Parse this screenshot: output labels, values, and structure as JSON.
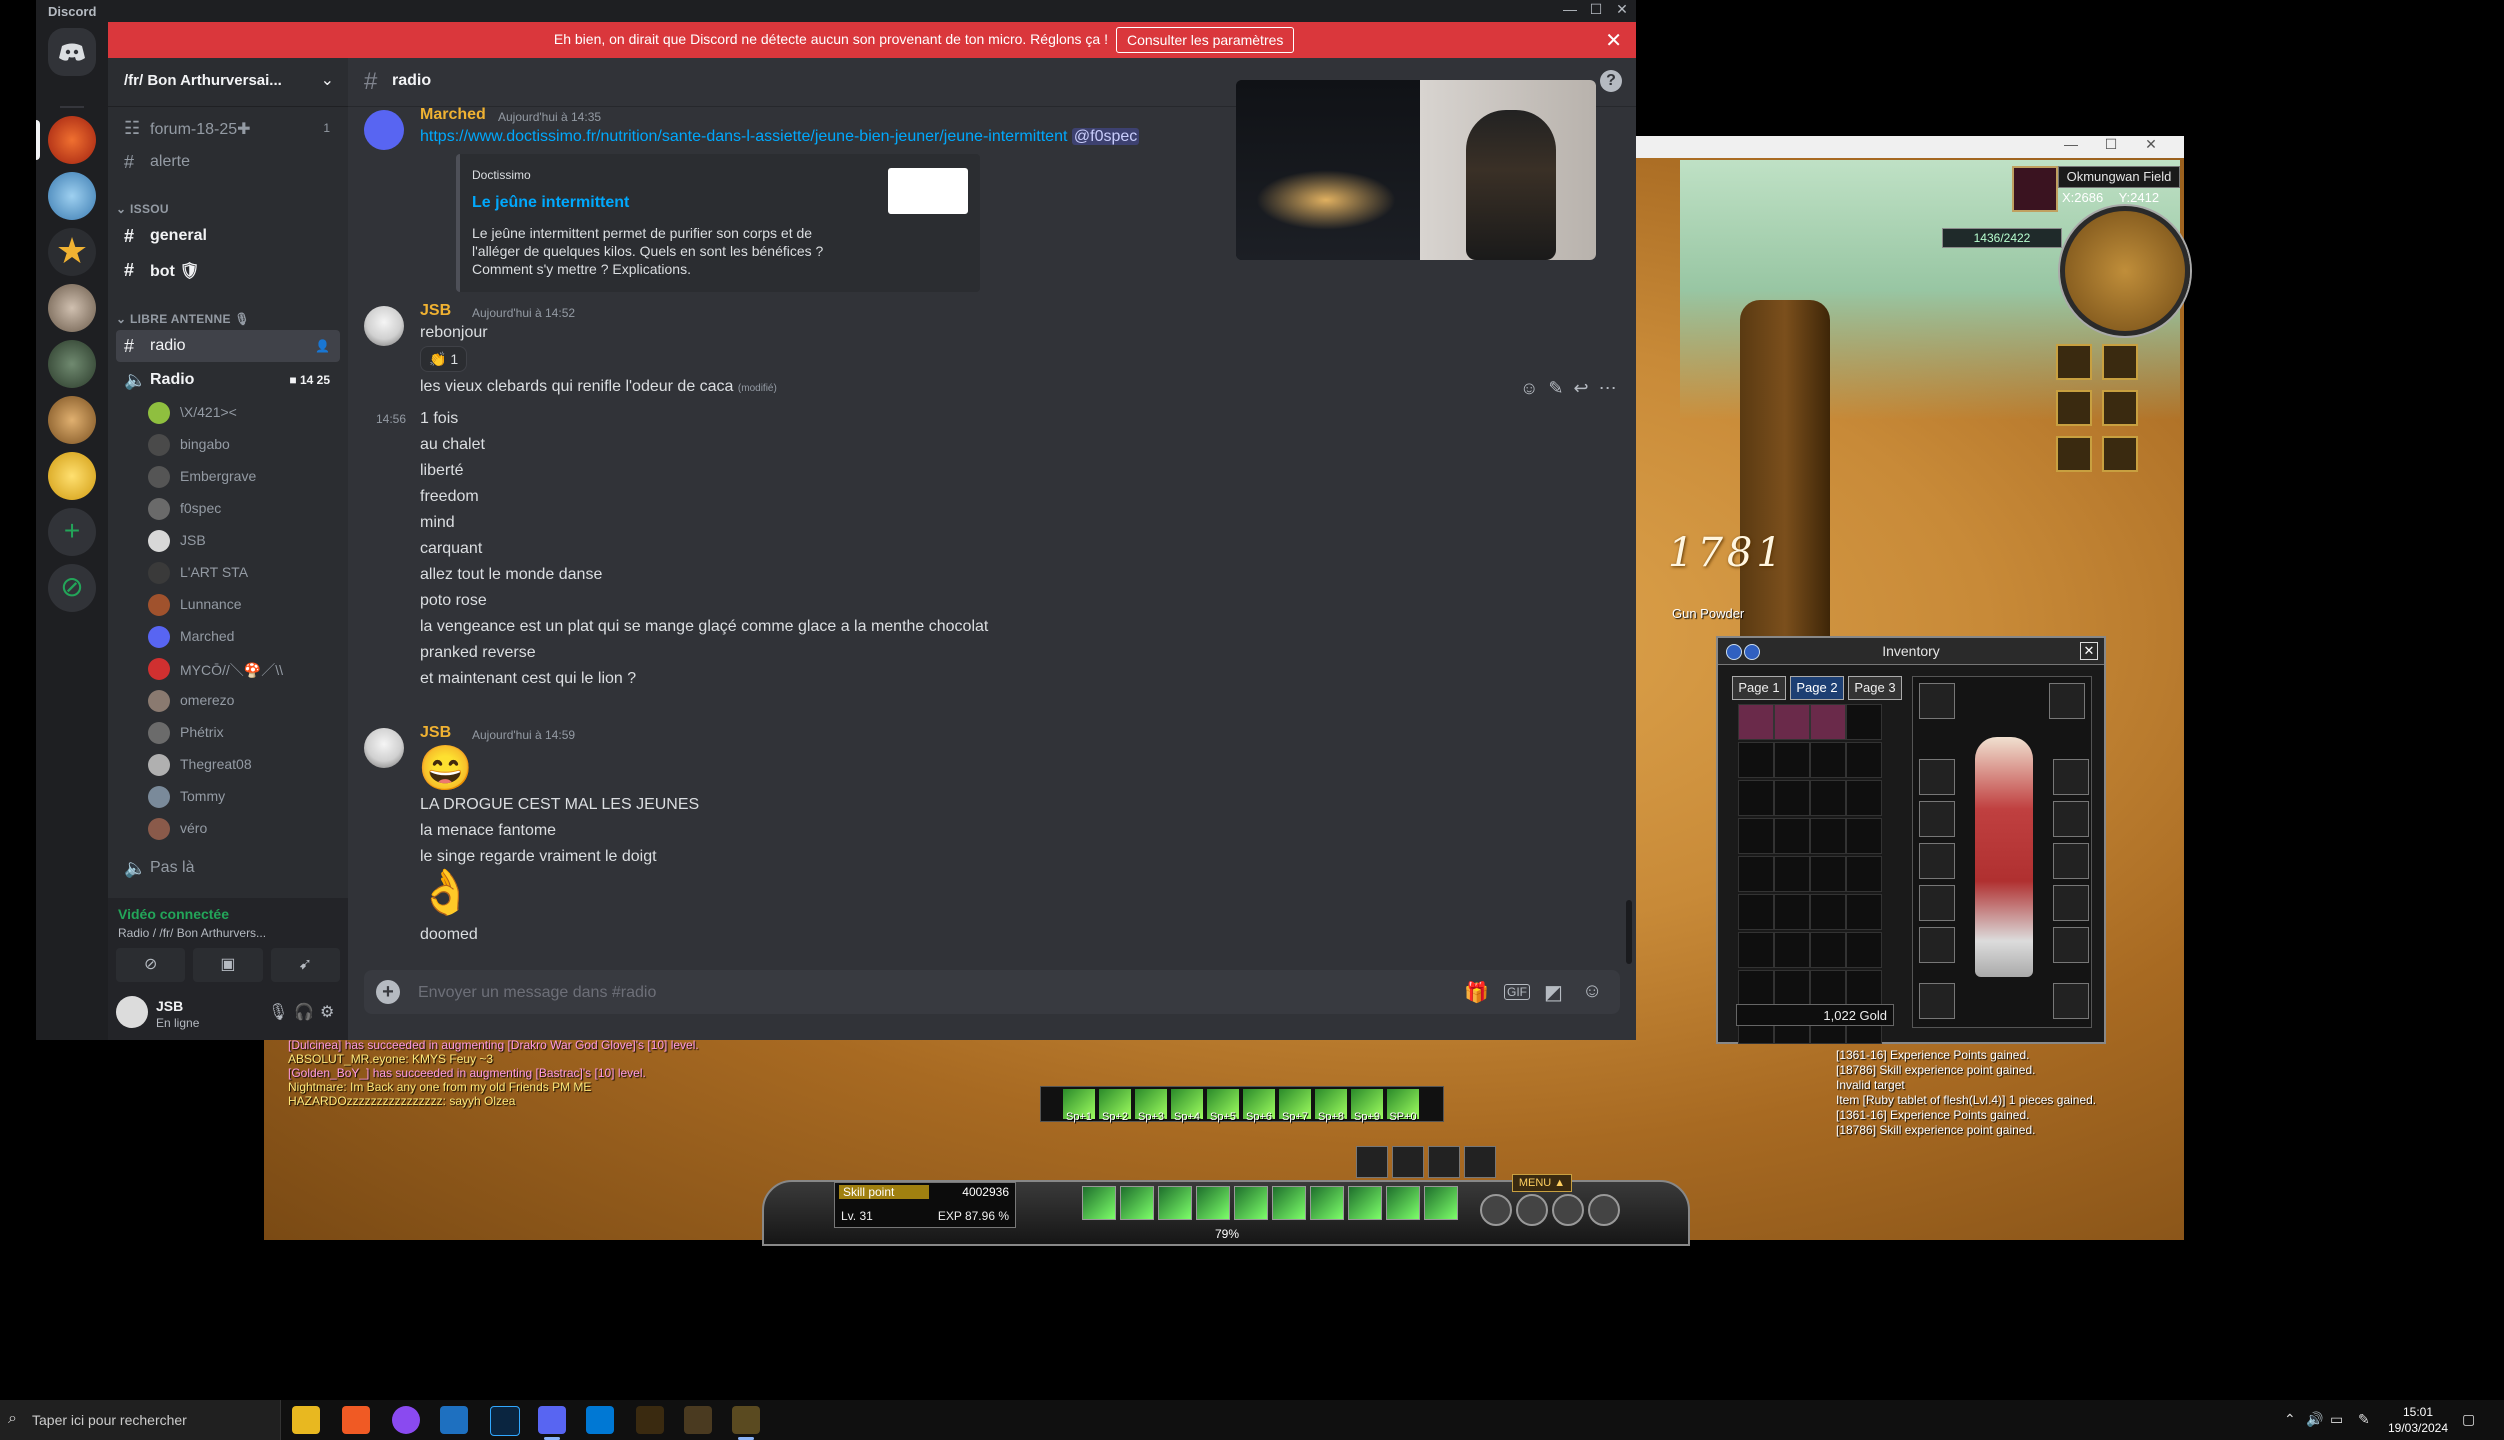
{
  "discord": {
    "window_title": "Discord",
    "banner": {
      "message": "Eh bien, on dirait que Discord ne détecte aucun son provenant de ton micro. Réglons ça !",
      "button": "Consulter les paramètres"
    },
    "server_name": "/fr/ Bon Arthurversai...",
    "channels": {
      "forum": {
        "label": "forum-18-25✚",
        "badge": "1"
      },
      "alerte": "alerte",
      "cat_issou": "ISSOU",
      "general": "general",
      "bot": "bot 🛡",
      "cat_antenne": "LIBRE ANTENNE 🎙",
      "radio": "radio",
      "voice_radio": {
        "label": "Radio",
        "count_left": "14",
        "count_right": "25"
      },
      "voice_pas_la": "Pas là"
    },
    "voice_users": [
      {
        "name": "\\X/421><",
        "color": "#8fbf3f"
      },
      {
        "name": "bingabo",
        "color": "#4a4a4a"
      },
      {
        "name": "Embergrave",
        "color": "#555555"
      },
      {
        "name": "f0spec",
        "color": "#6a6a6a"
      },
      {
        "name": "JSB",
        "color": "#d8d8d8"
      },
      {
        "name": "L'ART STA",
        "color": "#3a3a3a"
      },
      {
        "name": "Lunnance",
        "color": "#a0522d"
      },
      {
        "name": "Marched",
        "color": "#5865f2"
      },
      {
        "name": "MYCŌ//＼🍄／\\\\",
        "color": "#d03030"
      },
      {
        "name": "omerezo",
        "color": "#8a7a70"
      },
      {
        "name": "Phétrix",
        "color": "#6b6b6b"
      },
      {
        "name": "Thegreat08",
        "color": "#b0b0b0"
      },
      {
        "name": "Tommy",
        "color": "#7a8a9a"
      },
      {
        "name": "véro",
        "color": "#8a5a4a"
      }
    ],
    "voice_panel": {
      "status": "Vidéo connectée",
      "location": "Radio / /fr/ Bon Arthurvers..."
    },
    "user": {
      "name": "JSB",
      "status": "En ligne"
    },
    "channel_header": "radio",
    "messages": {
      "m1": {
        "author": "Marched",
        "author_color": "#f0b232",
        "time": "Aujourd'hui à 14:35",
        "link": "https://www.doctissimo.fr/nutrition/sante-dans-l-assiette/jeune-bien-jeuner/jeune-intermittent",
        "mention": "@f0spec",
        "embed": {
          "provider": "Doctissimo",
          "title": "Le jeûne intermittent",
          "description": "Le jeûne intermittent permet de purifier son corps et de l'alléger de quelques kilos. Quels en sont les bénéfices ? Comment s'y mettre ? Explications."
        }
      },
      "m2": {
        "author": "JSB",
        "author_color": "#f0b232",
        "time": "Aujourd'hui à 14:52",
        "first": "rebonjour",
        "reaction": "👏 1",
        "second": "les vieux clebards qui renifle l'odeur de caca",
        "edited": "(modifié)",
        "hover_time": "14:56",
        "lines": [
          "1 fois",
          "au chalet",
          "liberté",
          "freedom",
          "mind",
          "carquant",
          "allez tout le monde danse",
          "poto rose",
          "la vengeance est un plat qui se mange glaçé comme glace a la menthe chocolat",
          "pranked reverse",
          "et maintenant cest qui le lion ?"
        ]
      },
      "m3": {
        "author": "JSB",
        "author_color": "#f0b232",
        "time": "Aujourd'hui à 14:59",
        "emoji1": "😄",
        "lines": [
          "LA DROGUE CEST MAL LES JEUNES",
          "la menace fantome",
          "le singe regarde vraiment le doigt"
        ],
        "emoji2": "👌",
        "last": "doomed"
      }
    },
    "composer_placeholder": "Envoyer un message dans #radio"
  },
  "game": {
    "zone": "Okmungwan Field",
    "coords": {
      "x": "X:2686",
      "y": "Y:2412"
    },
    "hp": "1436/2422",
    "damage": "1781",
    "item_label": "Gun Powder",
    "inventory": {
      "title": "Inventory",
      "tabs": [
        "Page 1",
        "Page 2",
        "Page 3"
      ],
      "active_tab": 1,
      "gold": "1,022 Gold"
    },
    "system_log": [
      "[1361-16] Experience Points gained.",
      "[18786] Skill experience point gained.",
      "Invalid target",
      "Item [Ruby tablet of flesh(Lvl.4)] 1 pieces gained.",
      "[1361-16] Experience Points gained.",
      "[18786] Skill experience point gained."
    ],
    "chat_log": [
      {
        "text": "[Dulcinea] has succeeded in augmenting [Drakro War God Glove]'s [10] level.",
        "color": "#ff9ae0"
      },
      {
        "text": "ABSOLUT_MR.eyone: KMYS Feuy ~3",
        "color": "#ffe87a"
      },
      {
        "text": "[Golden_BoY_] has succeeded in augmenting [Bastrac]'s [10] level.",
        "color": "#ff9ae0"
      },
      {
        "text": "Nightmare: Im Back any one from my old Friends PM ME",
        "color": "#ffe87a"
      },
      {
        "text": "HAZARDOzzzzzzzzzzzzzzzz: sayyh Olzea",
        "color": "#ffe87a"
      }
    ],
    "skillbar_labels": [
      "Sp+1",
      "Sp+2",
      "Sp+3",
      "Sp+4",
      "Sp+5",
      "Sp+6",
      "Sp+7",
      "Sp+8",
      "Sp+9",
      "SP+0"
    ],
    "hud": {
      "skill_point_label": "Skill point",
      "skill_point_value": "4002936",
      "level": "Lv. 31",
      "exp": "EXP 87.96 %",
      "menu": "MENU ▲",
      "bottom_pct": "79%"
    }
  },
  "taskbar": {
    "search_placeholder": "Taper ici pour rechercher",
    "time": "15:01",
    "date": "19/03/2024"
  }
}
